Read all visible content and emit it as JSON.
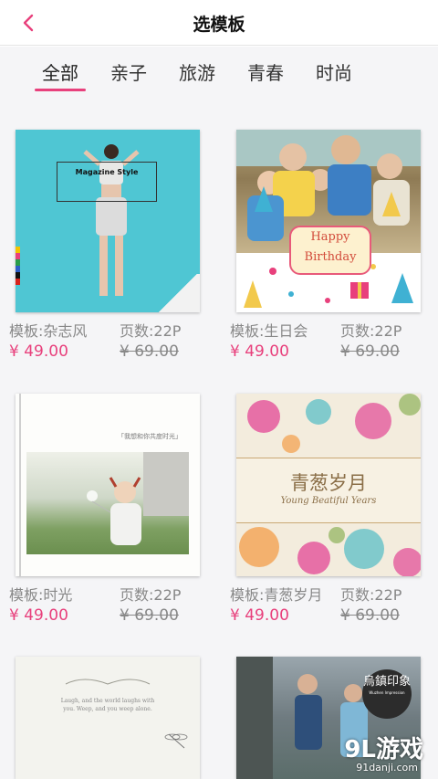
{
  "header": {
    "title": "选模板",
    "back_icon": "chevron-left-icon",
    "accent": "#e8407c"
  },
  "tabs": [
    {
      "label": "全部",
      "active": true
    },
    {
      "label": "亲子",
      "active": false
    },
    {
      "label": "旅游",
      "active": false
    },
    {
      "label": "青春",
      "active": false
    },
    {
      "label": "时尚",
      "active": false
    }
  ],
  "templates": [
    {
      "name": "模板:杂志风",
      "pages": "页数:22P",
      "price": "¥ 49.00",
      "old_price": "¥ 69.00",
      "cover_text": "Magazine Style"
    },
    {
      "name": "模板:生日会",
      "pages": "页数:22P",
      "price": "¥ 49.00",
      "old_price": "¥ 69.00",
      "cover_text_1": "Happy",
      "cover_text_2": "Birthday"
    },
    {
      "name": "模板:时光",
      "pages": "页数:22P",
      "price": "¥ 49.00",
      "old_price": "¥ 69.00",
      "cover_text": "「我想和你共度时光」"
    },
    {
      "name": "模板:青葱岁月",
      "pages": "页数:22P",
      "price": "¥ 49.00",
      "old_price": "¥ 69.00",
      "cover_text": "青葱岁月",
      "cover_subtext": "Young Beatiful Years"
    },
    {
      "cover_text": "Laugh, and the world laughs with you. Weep, and you weep alone."
    },
    {
      "cover_text": "烏鎮印象",
      "cover_subtext": "Wuzhen Impression"
    }
  ],
  "watermark": {
    "logo": "9L游戏",
    "url": "91danji.com"
  }
}
